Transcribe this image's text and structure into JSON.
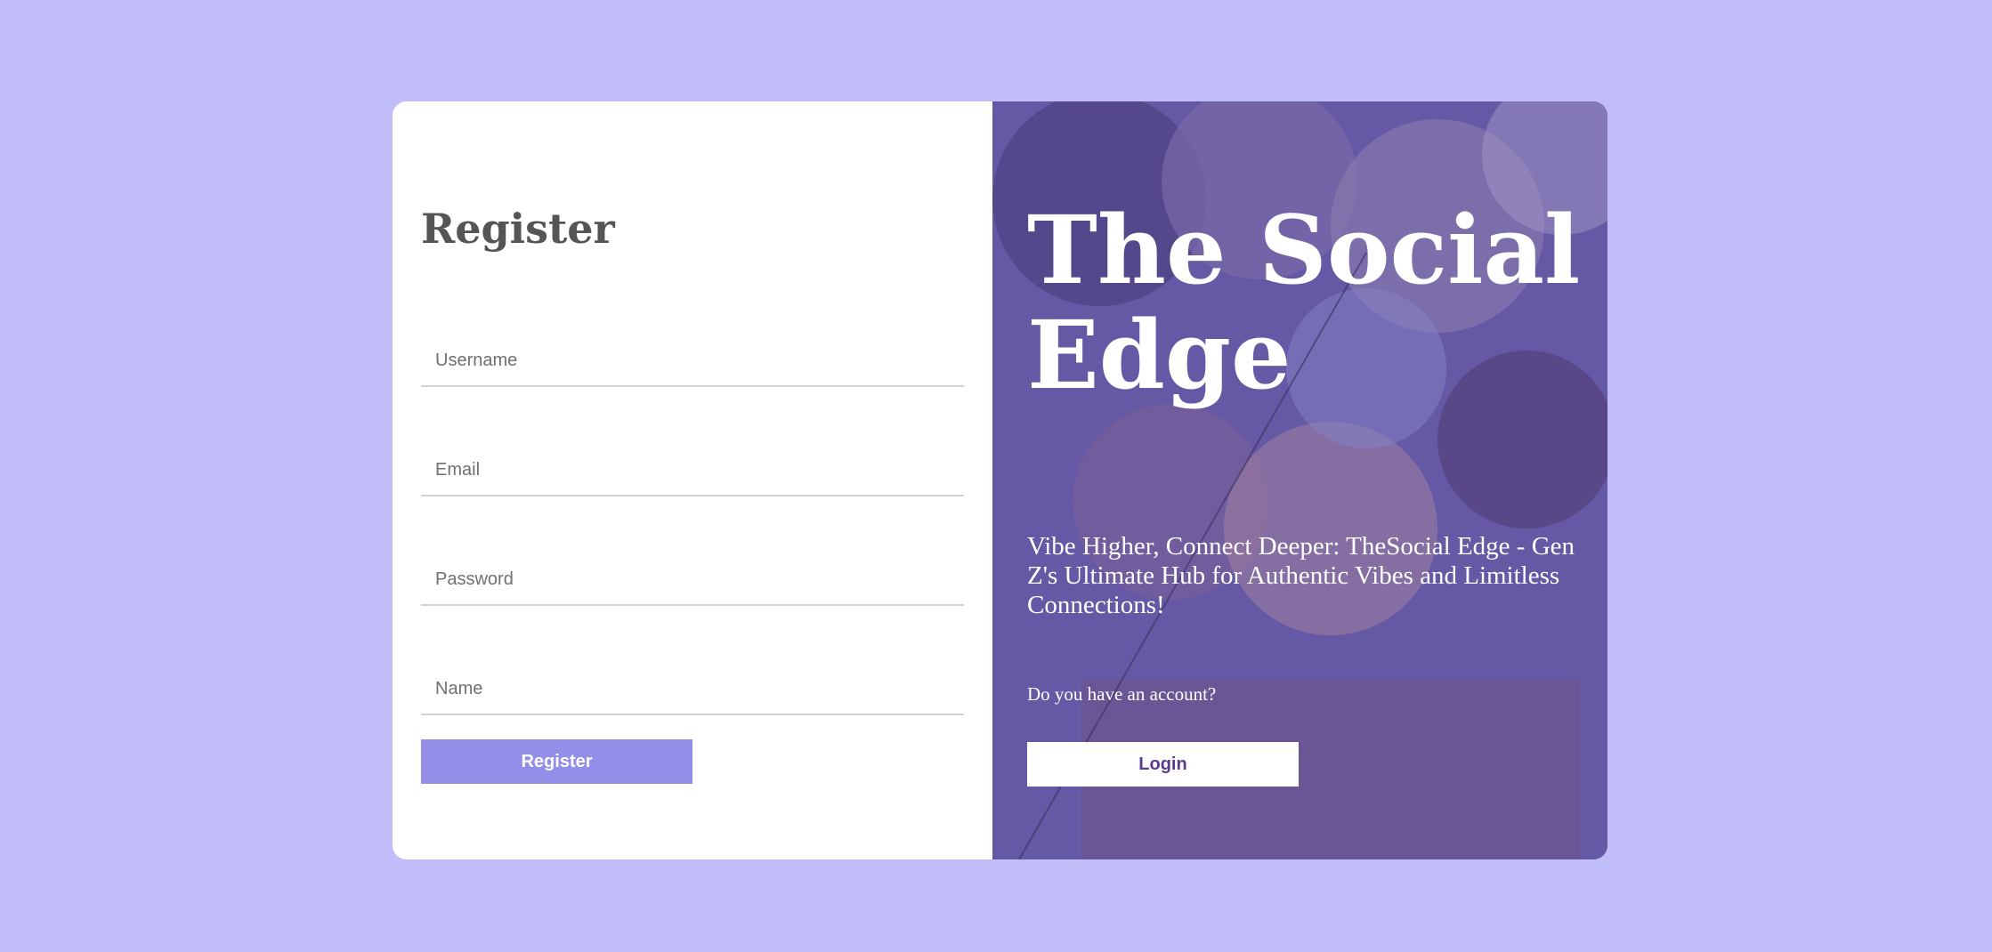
{
  "register": {
    "title": "Register",
    "fields": {
      "username_placeholder": "Username",
      "email_placeholder": "Email",
      "password_placeholder": "Password",
      "name_placeholder": "Name"
    },
    "button_label": "Register"
  },
  "hero": {
    "title": "The Social Edge",
    "tagline": "Vibe Higher, Connect Deeper: TheSocial Edge - Gen Z's Ultimate Hub for Authentic Vibes and Limitless Connections!",
    "question": "Do you have an account?",
    "login_label": "Login"
  },
  "colors": {
    "page_background": "#c0bdf8",
    "register_button": "#938ee8",
    "login_text": "#5a3a8c"
  }
}
